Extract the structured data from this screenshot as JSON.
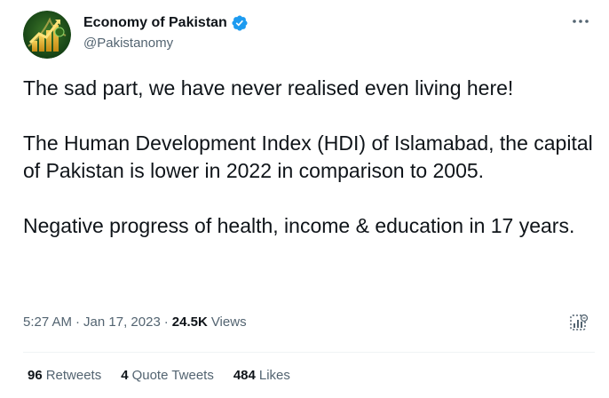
{
  "author": {
    "display_name": "Economy of Pakistan",
    "handle": "@Pakistanomy",
    "verified": true,
    "avatar_icon": "pakistan-economy-logo"
  },
  "tweet": {
    "text": "The sad part, we have never realised even living here!\n\nThe Human Development Index (HDI) of Islamabad, the capital of Pakistan is lower in 2022 in comparison to 2005.\n\nNegative progress of health, income & education in 17 years.",
    "time": "5:27 AM",
    "date": "Jan 17, 2023",
    "separator": "·",
    "views_count": "24.5K",
    "views_label": "Views"
  },
  "stats": {
    "retweets_count": "96",
    "retweets_label": "Retweets",
    "quotes_count": "4",
    "quotes_label": "Quote Tweets",
    "likes_count": "484",
    "likes_label": "Likes"
  },
  "colors": {
    "text_primary": "#0f1419",
    "text_secondary": "#536471",
    "verified_blue": "#1d9bf0",
    "divider": "#eff3f4"
  },
  "icons": {
    "more": "more-horizontal-icon",
    "verified": "verified-badge-icon",
    "analytics": "analytics-icon"
  }
}
